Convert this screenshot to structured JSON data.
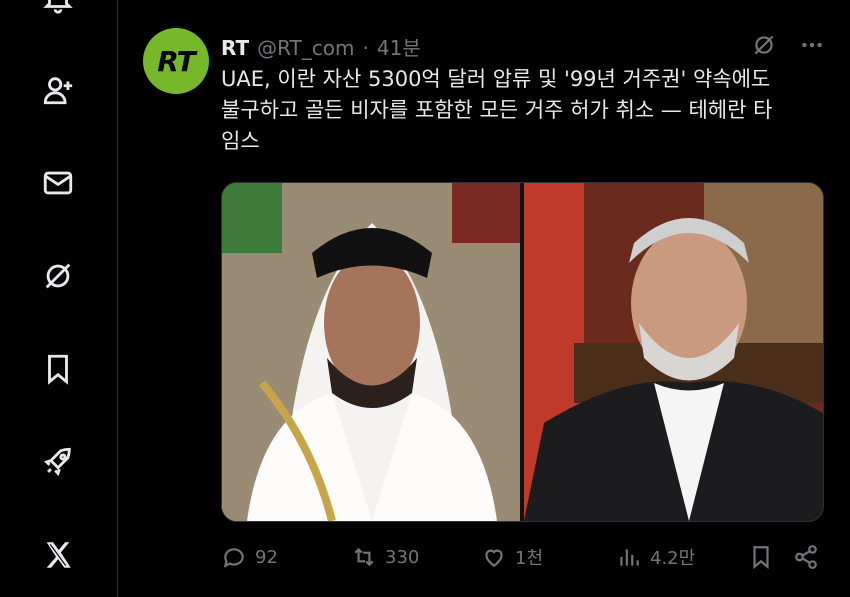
{
  "sidebar": {
    "items": [
      {
        "icon": "bell-icon"
      },
      {
        "icon": "add-user-icon"
      },
      {
        "icon": "mail-icon"
      },
      {
        "icon": "grok-slash-icon"
      },
      {
        "icon": "bookmark-icon"
      },
      {
        "icon": "rocket-icon"
      },
      {
        "icon": "x-logo-icon"
      }
    ]
  },
  "tweet": {
    "avatar_text": "RT",
    "name": "RT",
    "handle": "@RT_com",
    "separator": "·",
    "time": "41분",
    "text": "UAE, 이란 자산 5300억 달러 압류 및 '99년 거주권' 약속에도\n불구하고 골든 비자를 포함한 모든 거주 허가 취소 — 테헤란 타\n임스",
    "media": [
      {
        "icon": "photo-left"
      },
      {
        "icon": "photo-right"
      }
    ],
    "stats": {
      "replies": "92",
      "reposts": "330",
      "likes": "1천",
      "views": "4.2만"
    }
  },
  "colors": {
    "background": "#000000",
    "text": "#e7e9ea",
    "muted": "#71767b",
    "avatar": "#77b82a",
    "border": "#2f3336"
  }
}
